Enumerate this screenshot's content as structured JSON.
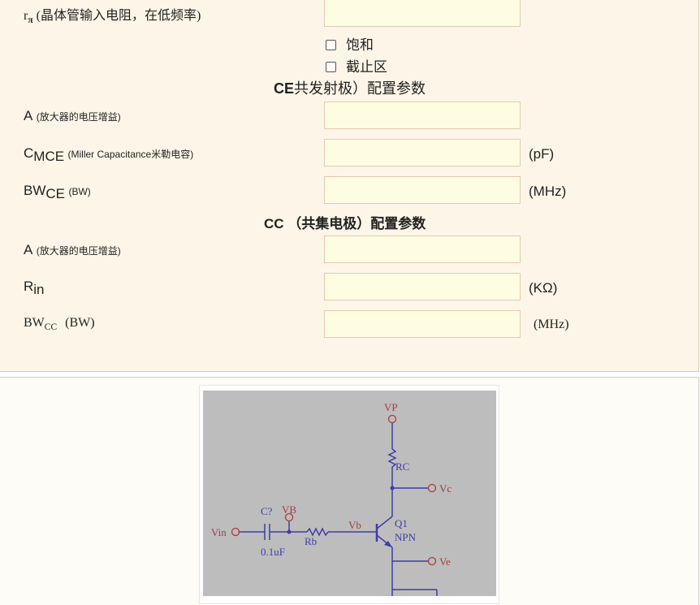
{
  "form": {
    "r_pi": {
      "symbol": "r",
      "sub": "π",
      "desc": "(晶体管输入电阻，在低频率)"
    },
    "checkboxes": [
      "饱和",
      "截止区"
    ],
    "ce_heading": {
      "bold": "CE",
      "rest": "共发射极）配置参数"
    },
    "ce": {
      "gain": {
        "main": "A",
        "desc": "(放大器的电压增益)"
      },
      "cmce": {
        "main": "C",
        "sub": "MCE",
        "desc": "(Miller Capacitance米勒电容)",
        "unit": "(pF)"
      },
      "bwce": {
        "main": "BW",
        "sub": "CE",
        "desc": "(BW)",
        "unit": "(MHz)"
      }
    },
    "cc_heading": "CC （共集电极）配置参数",
    "cc": {
      "gain": {
        "main": "A",
        "desc": "(放大器的电压增益)"
      },
      "rin": {
        "main": "R",
        "sub": "in",
        "unit": "(KΩ)"
      },
      "bwcc": {
        "main": "BW",
        "sub": "CC",
        "desc": "(BW)",
        "unit": "(MHz)"
      }
    }
  },
  "schematic": {
    "vp": "VP",
    "rc": "RC",
    "vc": "Vc",
    "q1": "Q1",
    "npn": "NPN",
    "ve": "Ve",
    "vb_label": "Vb",
    "vin": "Vin",
    "cap": "C?",
    "vb": "VB",
    "cap_value": "0.1uF",
    "rb": "Rb"
  },
  "colors": {
    "wire": "#3d3da8",
    "text": "#a83c3c"
  }
}
